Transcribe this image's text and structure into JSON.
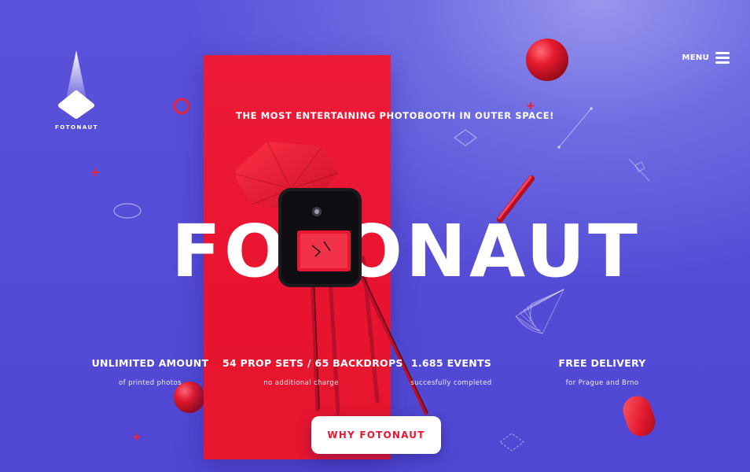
{
  "brand": {
    "logo_text": "FOTONAUT"
  },
  "header": {
    "menu_label": "MENU"
  },
  "hero": {
    "tagline": "THE MOST ENTERTAINING PHOTOBOOTH IN OUTER SPACE!",
    "title": "FOTONAUT"
  },
  "stats": [
    {
      "title": "UNLIMITED AMOUNT",
      "subtitle": "of printed photos"
    },
    {
      "title": "54 PROP SETS / 65 BACKDROPS",
      "subtitle": "no additional charge"
    },
    {
      "title": "1.685 EVENTS",
      "subtitle": "succesfully completed"
    },
    {
      "title": "FREE DELIVERY",
      "subtitle": "for Prague and Brno"
    }
  ],
  "cta": {
    "label": "WHY FOTONAUT"
  },
  "colors": {
    "background": "#5249d6",
    "accent_red": "#e8172f",
    "white": "#ffffff"
  },
  "icons": [
    "fotonaut-logo-icon",
    "menu-hamburger-icon"
  ]
}
